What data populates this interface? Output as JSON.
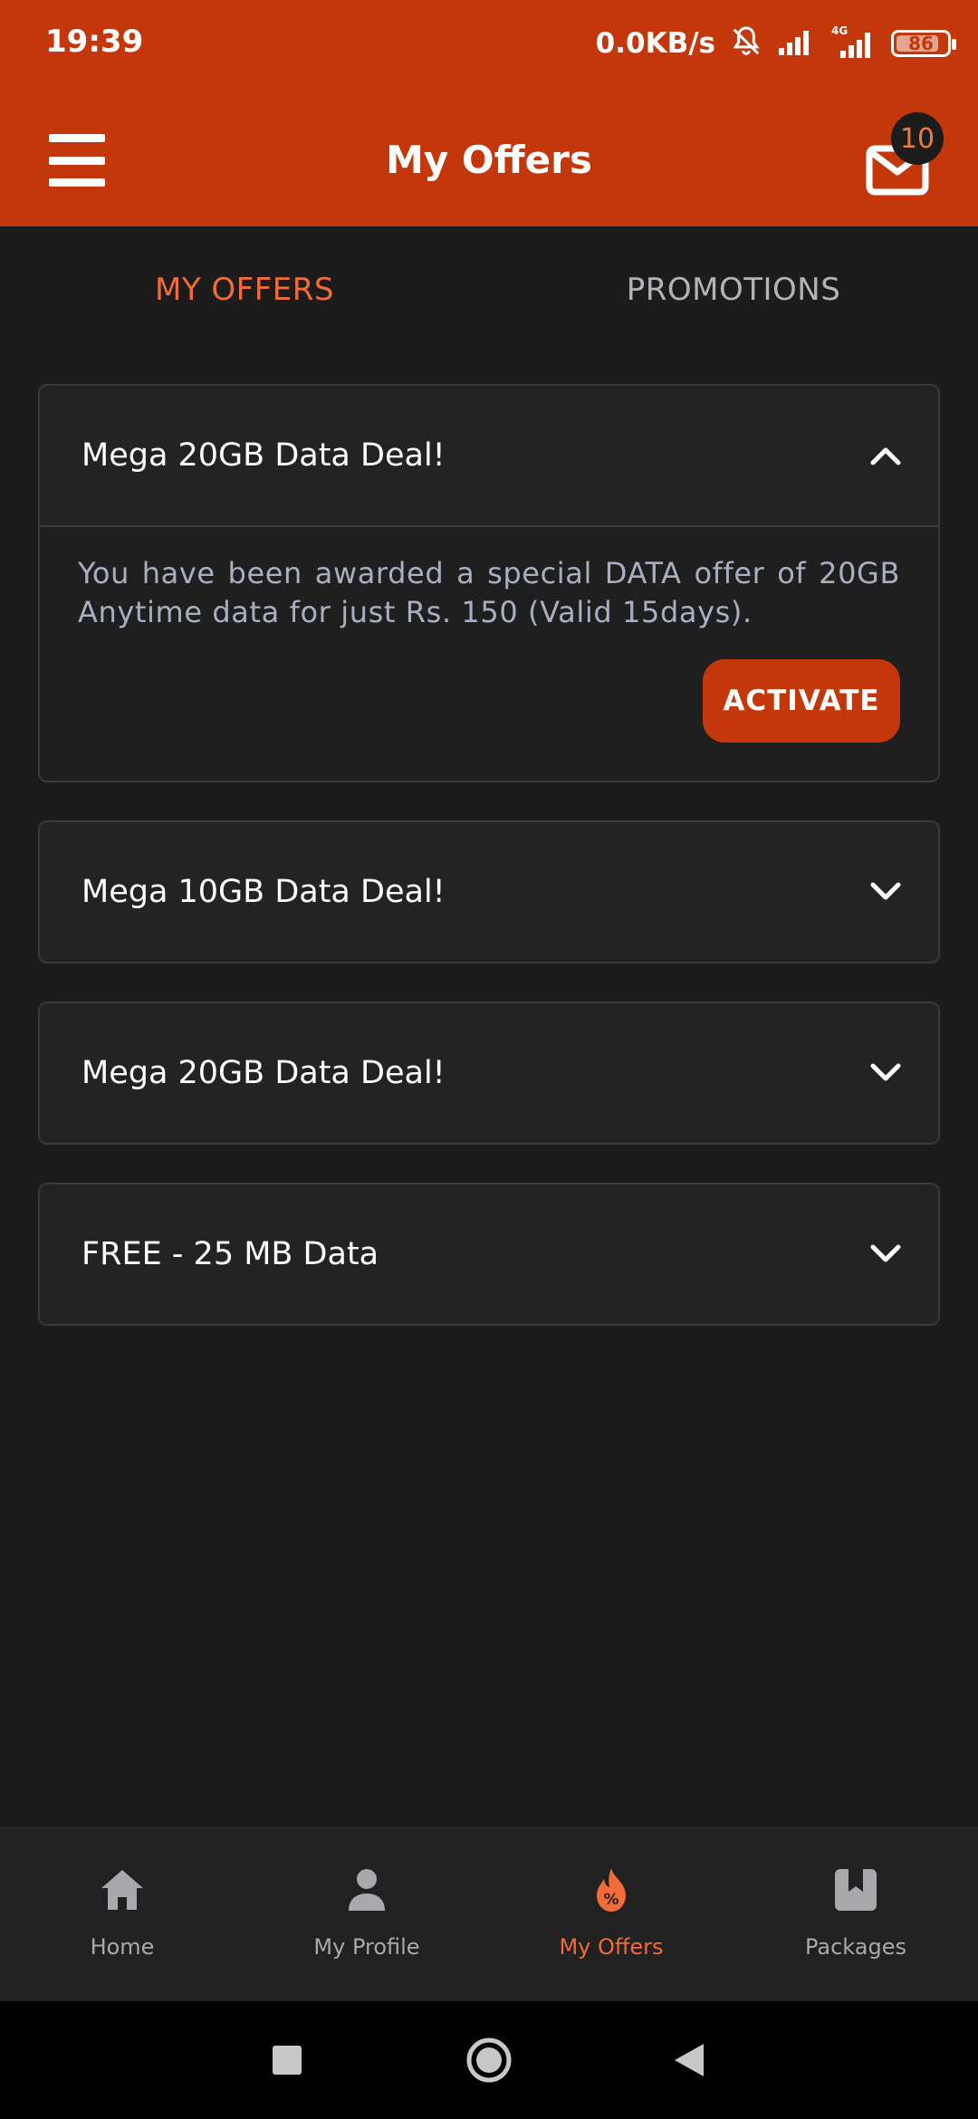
{
  "status_bar": {
    "time": "19:39",
    "speed": "0.0KB/s",
    "battery": "86",
    "network_label": "4G"
  },
  "header": {
    "title": "My Offers",
    "inbox_badge": "10"
  },
  "tabs": [
    {
      "label": "MY OFFERS",
      "active": true
    },
    {
      "label": "PROMOTIONS",
      "active": false
    }
  ],
  "offers": [
    {
      "title": "Mega 20GB Data Deal!",
      "expanded": true,
      "description": "You have been awarded a special DATA offer of 20GB Anytime data for just Rs. 150 (Valid 15days).",
      "action_label": "ACTIVATE"
    },
    {
      "title": "Mega 10GB Data Deal!",
      "expanded": false
    },
    {
      "title": "Mega 20GB Data Deal!",
      "expanded": false
    },
    {
      "title": "FREE - 25 MB Data",
      "expanded": false
    }
  ],
  "bottom_nav": [
    {
      "label": "Home",
      "icon": "home-icon"
    },
    {
      "label": "My Profile",
      "icon": "person-icon"
    },
    {
      "label": "My Offers",
      "icon": "offers-icon",
      "active": true
    },
    {
      "label": "Packages",
      "icon": "package-icon"
    }
  ],
  "colors": {
    "brand": "#c3370a",
    "accent": "#f26b38",
    "background": "#1c1c1c"
  }
}
